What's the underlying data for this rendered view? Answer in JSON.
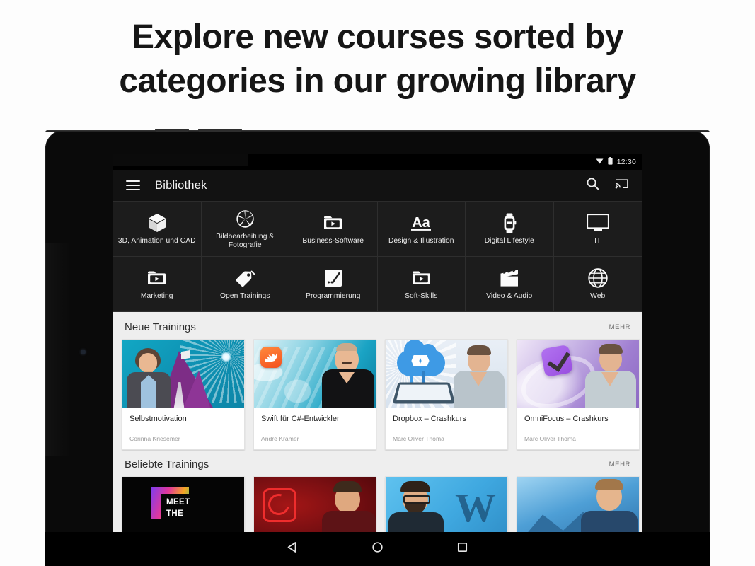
{
  "headline": {
    "line1": "Explore new courses sorted by",
    "line2": "categories in our growing library"
  },
  "device": {
    "type": "android-tablet",
    "frame_color": "#0a0a0a"
  },
  "statusbar": {
    "time": "12:30",
    "icons": [
      "wifi-icon",
      "battery-icon"
    ]
  },
  "appbar": {
    "menu_icon": "hamburger-menu-icon",
    "title": "Bibliothek",
    "actions": [
      {
        "name": "search-icon",
        "label": "Suche"
      },
      {
        "name": "cast-icon",
        "label": "Cast"
      }
    ]
  },
  "categories": [
    {
      "label": "3D, Animation und CAD",
      "icon": "cube-icon"
    },
    {
      "label": "Bildbearbeitung & Fotografie",
      "icon": "aperture-icon"
    },
    {
      "label": "Business-Software",
      "icon": "video-folder-icon"
    },
    {
      "label": "Design & Illustration",
      "icon": "typography-aa-icon"
    },
    {
      "label": "Digital Lifestyle",
      "icon": "smartwatch-icon"
    },
    {
      "label": "IT",
      "icon": "monitor-icon"
    },
    {
      "label": "Marketing",
      "icon": "video-folder-icon"
    },
    {
      "label": "Open Trainings",
      "icon": "price-tag-icon"
    },
    {
      "label": "Programmierung",
      "icon": "code-slash-icon"
    },
    {
      "label": "Soft-Skills",
      "icon": "video-folder-icon"
    },
    {
      "label": "Video & Audio",
      "icon": "clapperboard-icon"
    },
    {
      "label": "Web",
      "icon": "globe-icon"
    }
  ],
  "sections": [
    {
      "title": "Neue Trainings",
      "more_label": "MEHR",
      "cards": [
        {
          "title": "Selbstmotivation",
          "author": "Corinna Kriesemer",
          "thumb": "selbstmotivation-thumb"
        },
        {
          "title": "Swift für C#-Entwickler",
          "author": "André Krämer",
          "thumb": "swift-thumb"
        },
        {
          "title": "Dropbox – Crashkurs",
          "author": "Marc Oliver Thoma",
          "thumb": "dropbox-thumb"
        },
        {
          "title": "OmniFocus – Crashkurs",
          "author": "Marc Oliver Thoma",
          "thumb": "omnifocus-thumb"
        }
      ]
    },
    {
      "title": "Beliebte Trainings",
      "more_label": "MEHR",
      "cards": [
        {
          "title": "",
          "author": "",
          "thumb": "meet-the-expert-thumb",
          "overlay_line1": "MEET",
          "overlay_line2": "THE"
        },
        {
          "title": "",
          "author": "",
          "thumb": "creative-cloud-thumb"
        },
        {
          "title": "",
          "author": "",
          "thumb": "wordpress-thumb"
        },
        {
          "title": "",
          "author": "",
          "thumb": "blue-mountain-thumb"
        }
      ]
    }
  ],
  "navbar": {
    "buttons": [
      {
        "name": "back-button",
        "icon": "triangle-back-icon"
      },
      {
        "name": "home-button",
        "icon": "circle-home-icon"
      },
      {
        "name": "recents-button",
        "icon": "square-recents-icon"
      }
    ]
  },
  "colors": {
    "page_background": "#fdfdfd",
    "headline_text": "#161616",
    "appbar_background": "#121212",
    "category_grid_background": "#1c1c1c",
    "content_background": "#eeeeee",
    "card_background": "#ffffff",
    "more_link": "#6b6b6b"
  }
}
